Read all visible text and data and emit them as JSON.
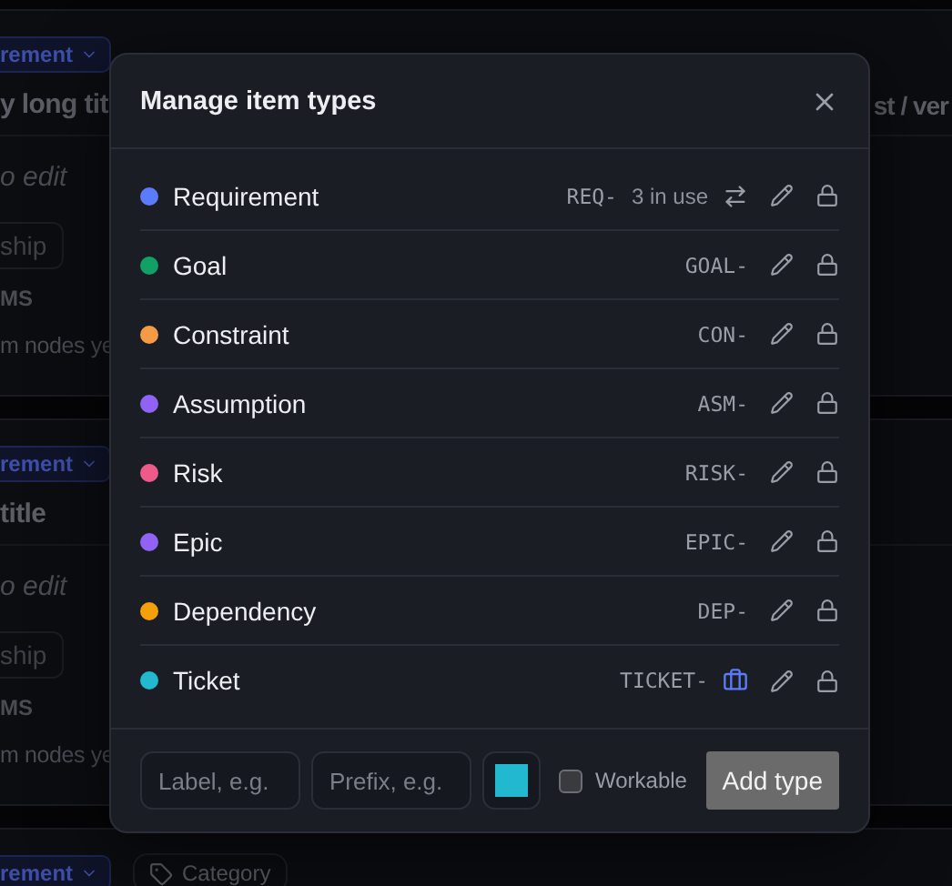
{
  "background_cards": [
    {
      "type_badge": "rement",
      "title_start": "y long tit",
      "title_end": "st / ver",
      "description": "o edit",
      "relationship_button": "ship",
      "section_heading": "MS",
      "empty_note": "m nodes ye"
    },
    {
      "type_badge": "rement",
      "title_start": "title",
      "description": "o edit",
      "relationship_button": "ship",
      "section_heading": "MS",
      "empty_note": "m nodes ye"
    },
    {
      "type_badge": "rement",
      "category": "Category"
    }
  ],
  "dialog": {
    "title": "Manage item types",
    "types": [
      {
        "label": "Requirement",
        "color": "#5b7cfa",
        "prefix": "REQ-",
        "usage": "3 in use",
        "workable": false
      },
      {
        "label": "Goal",
        "color": "#12a066",
        "prefix": "GOAL-",
        "workable": false
      },
      {
        "label": "Constraint",
        "color": "#f59a45",
        "prefix": "CON-",
        "workable": false
      },
      {
        "label": "Assumption",
        "color": "#9163f5",
        "prefix": "ASM-",
        "workable": false
      },
      {
        "label": "Risk",
        "color": "#ee5a8a",
        "prefix": "RISK-",
        "workable": false
      },
      {
        "label": "Epic",
        "color": "#9163f5",
        "prefix": "EPIC-",
        "workable": false
      },
      {
        "label": "Dependency",
        "color": "#f59f0b",
        "prefix": "DEP-",
        "workable": false
      },
      {
        "label": "Ticket",
        "color": "#22b8cf",
        "prefix": "TICKET-",
        "workable": true
      }
    ],
    "form": {
      "label_placeholder": "Label, e.g.",
      "prefix_placeholder": "Prefix, e.g.",
      "color": "#22b8cf",
      "workable": {
        "label": "Workable",
        "checked": false
      },
      "submit": {
        "label": "Add type",
        "disabled": true
      }
    }
  }
}
